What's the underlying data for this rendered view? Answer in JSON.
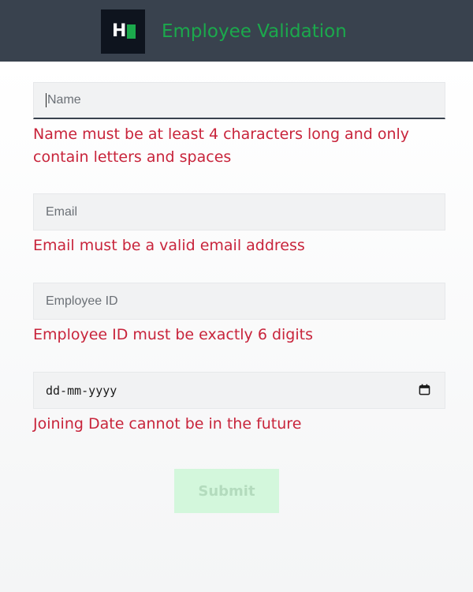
{
  "header": {
    "logo_text": "H",
    "title": "Employee Validation"
  },
  "form": {
    "name": {
      "placeholder": "Name",
      "value": "",
      "error": "Name must be at least 4 characters long and only contain letters and spaces"
    },
    "email": {
      "placeholder": "Email",
      "value": "",
      "error": "Email must be a valid email address"
    },
    "employee_id": {
      "placeholder": "Employee ID",
      "value": "",
      "error": "Employee ID must be exactly 6 digits"
    },
    "joining_date": {
      "placeholder": "dd-mm-yyyy",
      "value": "",
      "error": "Joining Date cannot be in the future"
    },
    "submit_label": "Submit",
    "submit_disabled": true
  },
  "icons": {
    "calendar": "calendar-icon"
  },
  "colors": {
    "header_bg": "#39424e",
    "accent_green": "#1ba94c",
    "error_red": "#c8243b",
    "submit_disabled_bg": "#d3f7dc"
  }
}
